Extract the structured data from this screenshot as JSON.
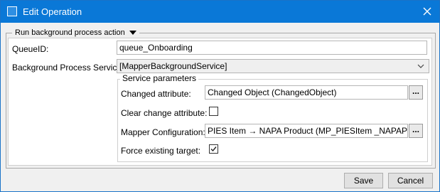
{
  "window": {
    "title": "Edit Operation",
    "accent": "#0a78d7"
  },
  "group": {
    "legend": "Run background process action"
  },
  "form": {
    "queue_label": "QueueID:",
    "queue_value": "queue_Onboarding",
    "service_label": "Background Process Service:",
    "service_value": "[MapperBackgroundService]"
  },
  "service_parameters": {
    "legend": "Service parameters",
    "changed_attribute_label": "Changed attribute:",
    "changed_attribute_value": "Changed Object (ChangedObject)",
    "clear_change_label": "Clear change attribute:",
    "clear_change_checked": false,
    "mapper_config_label": "Mapper Configuration:",
    "mapper_config_value": "PIES Item → NAPA Product (MP_PIESItem _NAPAProduct)",
    "force_existing_label": "Force existing target:",
    "force_existing_checked": true,
    "browse_label": "..."
  },
  "buttons": {
    "save": "Save",
    "cancel": "Cancel"
  }
}
